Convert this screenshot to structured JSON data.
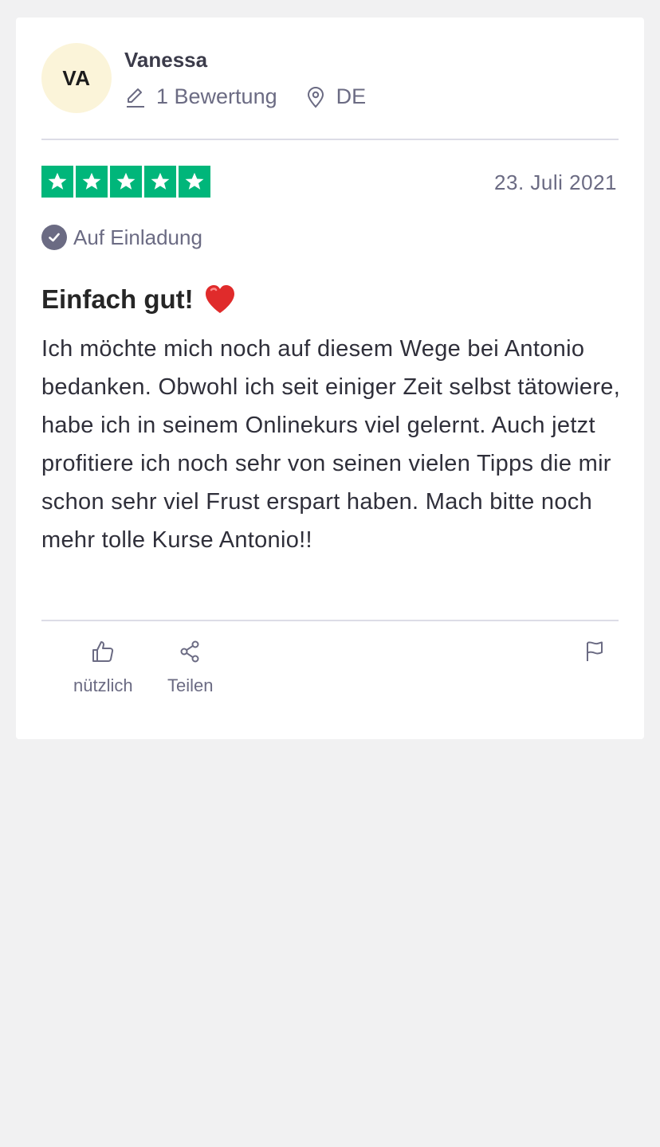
{
  "reviewer": {
    "initials": "VA",
    "name": "Vanessa",
    "review_count": "1 Bewertung",
    "country": "DE"
  },
  "review": {
    "rating": 5,
    "date": "23. Juli 2021",
    "verification": "Auf Einladung",
    "title": "Einfach gut!",
    "body": "Ich möchte mich noch auf diesem Wege bei Antonio bedanken. Obwohl ich seit einiger Zeit selbst tätowiere, habe ich in seinem Onlinekurs viel gelernt. Auch jetzt profitiere ich noch sehr von seinen vielen Tipps die mir schon sehr viel Frust erspart haben. Mach bitte noch mehr tolle Kurse Antonio!!"
  },
  "actions": {
    "useful_label": "nützlich",
    "share_label": "Teilen"
  },
  "colors": {
    "star_green": "#00b67a",
    "avatar_bg": "#fbf4d9",
    "muted_text": "#6b6b83"
  },
  "icons": {
    "review_count": "pencil-icon",
    "country": "location-pin-icon",
    "verification": "check-circle-icon",
    "title_emoji": "heart-icon",
    "useful": "thumbs-up-icon",
    "share": "share-icon",
    "report": "flag-icon"
  }
}
